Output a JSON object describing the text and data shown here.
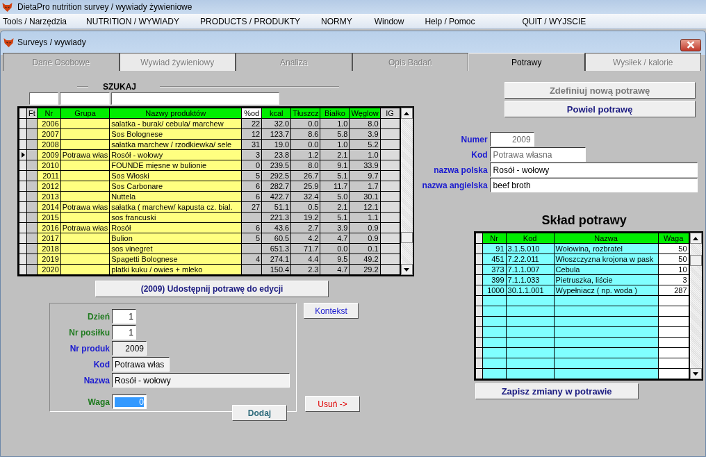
{
  "app_title": "DietaPro   nutrition survey / wywiady żywieniowe",
  "menu": [
    "Tools / Narzędzia",
    "NUTRITION / WYWIADY",
    "PRODUCTS / PRODUKTY",
    "NORMY",
    "Window",
    "Help / Pomoc",
    "QUIT / WYJSCIE"
  ],
  "window": {
    "title": "Surveys / wywiady"
  },
  "tabs": [
    {
      "label": "Dane Osobowe",
      "selected": false,
      "disabled": true
    },
    {
      "label": "Wywiad żywieniowy",
      "selected": false,
      "disabled": true
    },
    {
      "label": "Analiza",
      "selected": false,
      "disabled": true
    },
    {
      "label": "Opis Badań",
      "selected": false,
      "disabled": true
    },
    {
      "label": "Potrawy",
      "selected": true,
      "disabled": false
    },
    {
      "label": "Wysiłek / kalorie",
      "selected": false,
      "disabled": true
    }
  ],
  "search": {
    "label": "SZUKAJ"
  },
  "products": {
    "columns": [
      "Ft",
      "Nr",
      "Grupa",
      "Nazwy produktów",
      "%od",
      "kcal",
      "Tłuszcz",
      "Białko",
      "Węglow",
      "IG"
    ],
    "rows": [
      {
        "selected": false,
        "nr": "2006",
        "name": "salatka - burak/ cebula/ marchew",
        "pct": "22",
        "kcal": "32.0",
        "fat": "0.0",
        "protein": "1.0",
        "carbs": "8.0"
      },
      {
        "selected": false,
        "nr": "2007",
        "name": "Sos Bolognese",
        "pct": "12",
        "kcal": "123.7",
        "fat": "8.6",
        "protein": "5.8",
        "carbs": "3.9"
      },
      {
        "selected": false,
        "nr": "2008",
        "name": "sałatka marchew / rzodkiewka/ sele",
        "pct": "31",
        "kcal": "19.0",
        "fat": "0.0",
        "protein": "1.0",
        "carbs": "5.2"
      },
      {
        "selected": true,
        "nr": "2009",
        "group": "Potrawa włas",
        "name": "Rosół - wołowy",
        "pct": "3",
        "kcal": "23.8",
        "fat": "1.2",
        "protein": "2.1",
        "carbs": "1.0"
      },
      {
        "selected": false,
        "nr": "2010",
        "name": "FOUNDE mięsne w bulionie",
        "pct": "0",
        "kcal": "239.5",
        "fat": "8.0",
        "protein": "9.1",
        "carbs": "33.9"
      },
      {
        "selected": false,
        "nr": "2011",
        "name": "Sos Włoski",
        "pct": "5",
        "kcal": "292.5",
        "fat": "26.7",
        "protein": "5.1",
        "carbs": "9.7"
      },
      {
        "selected": false,
        "nr": "2012",
        "name": "Sos Carbonare",
        "pct": "6",
        "kcal": "282.7",
        "fat": "25.9",
        "protein": "11.7",
        "carbs": "1.7"
      },
      {
        "selected": false,
        "nr": "2013",
        "name": "Nuttela",
        "pct": "6",
        "kcal": "422.7",
        "fat": "32.4",
        "protein": "5.0",
        "carbs": "30.1"
      },
      {
        "selected": false,
        "nr": "2014",
        "group": "Potrawa włas",
        "name": "sałatka ( marchew/ kapusta cz. bial.",
        "pct": "27",
        "kcal": "51.1",
        "fat": "0.5",
        "protein": "2.1",
        "carbs": "12.1"
      },
      {
        "selected": false,
        "nr": "2015",
        "name": "sos francuski",
        "kcal": "221.3",
        "fat": "19.2",
        "protein": "5.1",
        "carbs": "1.1"
      },
      {
        "selected": false,
        "nr": "2016",
        "group": "Potrawa włas",
        "name": "Rosół",
        "pct": "6",
        "kcal": "43.6",
        "fat": "2.7",
        "protein": "3.9",
        "carbs": "0.9"
      },
      {
        "selected": false,
        "nr": "2017",
        "name": "Bulion",
        "pct": "5",
        "kcal": "60.5",
        "fat": "4.2",
        "protein": "4.7",
        "carbs": "0.9"
      },
      {
        "selected": false,
        "nr": "2018",
        "name": "sos vinegret",
        "kcal": "651.3",
        "fat": "71.7",
        "protein": "0.0",
        "carbs": "0.1"
      },
      {
        "selected": false,
        "nr": "2019",
        "name": "Spagetti Bolognese",
        "pct": "4",
        "kcal": "274.1",
        "fat": "4.4",
        "protein": "9.5",
        "carbs": "49.2"
      },
      {
        "selected": false,
        "nr": "2020",
        "name": "platki kuku / owies + mleko",
        "kcal": "150.4",
        "fat": "2.3",
        "protein": "4.7",
        "carbs": "29.2"
      }
    ]
  },
  "edit_button": "(2009) Udostępnij potrawę do edycji",
  "entry": {
    "fields": [
      {
        "label": "Dzień",
        "value": "1",
        "kind": "day",
        "highlighted": false
      },
      {
        "label": "Nr posiłku",
        "value": "1",
        "kind": "meal",
        "highlighted": false
      },
      {
        "label": "Nr produk",
        "value": "2009",
        "kind": "product",
        "highlighted": false
      },
      {
        "label": "Kod",
        "value": "Potrawa włas",
        "kind": "code",
        "highlighted": false
      },
      {
        "label": "Nazwa",
        "value": "Rosół - wołowy",
        "kind": "name",
        "highlighted": false
      },
      {
        "label": "Waga",
        "value": "0",
        "kind": "weight",
        "highlighted": true
      }
    ],
    "add_button": "Dodaj"
  },
  "context_button": "Kontekst",
  "remove_button": "Usuń ->",
  "define_button": {
    "label": "Zdefiniuj nową potrawę",
    "disabled": true
  },
  "copy_button": {
    "label": "Powiel potrawę",
    "disabled": false
  },
  "dish": {
    "fields": [
      {
        "label": "Numer",
        "value": "2009",
        "kind": "number"
      },
      {
        "label": "Kod",
        "value": "Potrawa własna",
        "kind": "code"
      },
      {
        "label": "nazwa polska",
        "value": "Rosół - wołowy",
        "kind": "text"
      },
      {
        "label": "nazwa angielska",
        "value": "beef broth",
        "kind": "text"
      }
    ]
  },
  "composition": {
    "title": "Skład potrawy",
    "columns": [
      "Nr",
      "Kod",
      "Nazwa",
      "Waga"
    ],
    "rows": [
      {
        "nr": "91",
        "code": "3.1.5.010",
        "name": "Wołowina, rozbratel",
        "weight": "50"
      },
      {
        "nr": "451",
        "code": "7.2.2.011",
        "name": "Włoszczyzna krojona w pask",
        "weight": "50"
      },
      {
        "nr": "373",
        "code": "7.1.1.007",
        "name": "Cebula",
        "weight": "10"
      },
      {
        "nr": "399",
        "code": "7.1.1.033",
        "name": "Pietruszka, liście",
        "weight": "3"
      },
      {
        "nr": "1000",
        "code": "30.1.1.001",
        "name": "Wypełniacz ( np. woda )",
        "weight": "287"
      }
    ]
  },
  "save_button": "Zapisz zmiany w potrawie"
}
